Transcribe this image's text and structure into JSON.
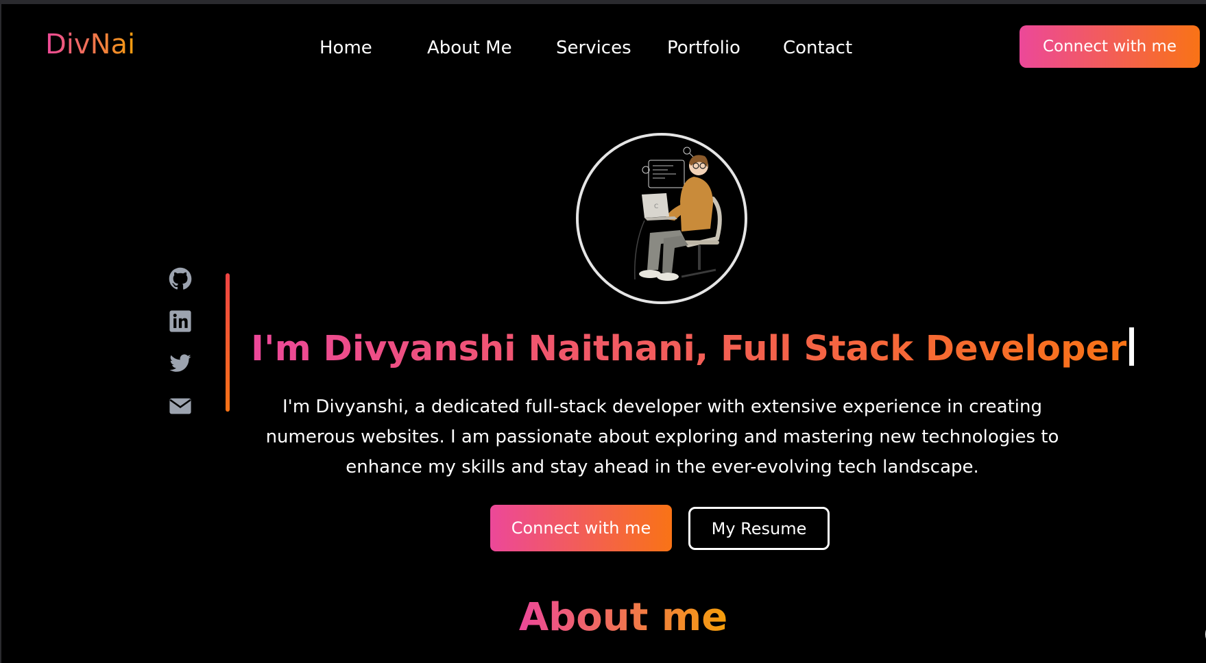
{
  "header": {
    "logo": "DivNai",
    "nav": [
      "Home",
      "About Me",
      "Services",
      "Portfolio",
      "Contact"
    ],
    "cta_label": "Connect with me"
  },
  "hero": {
    "headline": "I'm Divyanshi Naithani, Full Stack Developer",
    "intro": "I'm Divyanshi, a dedicated full-stack developer with extensive experience in creating numerous websites. I am passionate about exploring and mastering new technologies to enhance my skills and stay ahead in the ever-evolving tech landscape.",
    "primary_button": "Connect with me",
    "secondary_button": "My Resume",
    "socials": [
      "github-icon",
      "linkedin-icon",
      "twitter-icon",
      "envelope-icon"
    ],
    "avatar_icon": "developer-illustration"
  },
  "about": {
    "title": "About me"
  },
  "colors": {
    "background": "#000000",
    "gradient_start": "#ec4899",
    "gradient_end": "#f97316",
    "icon_gray": "#9ca3af"
  }
}
